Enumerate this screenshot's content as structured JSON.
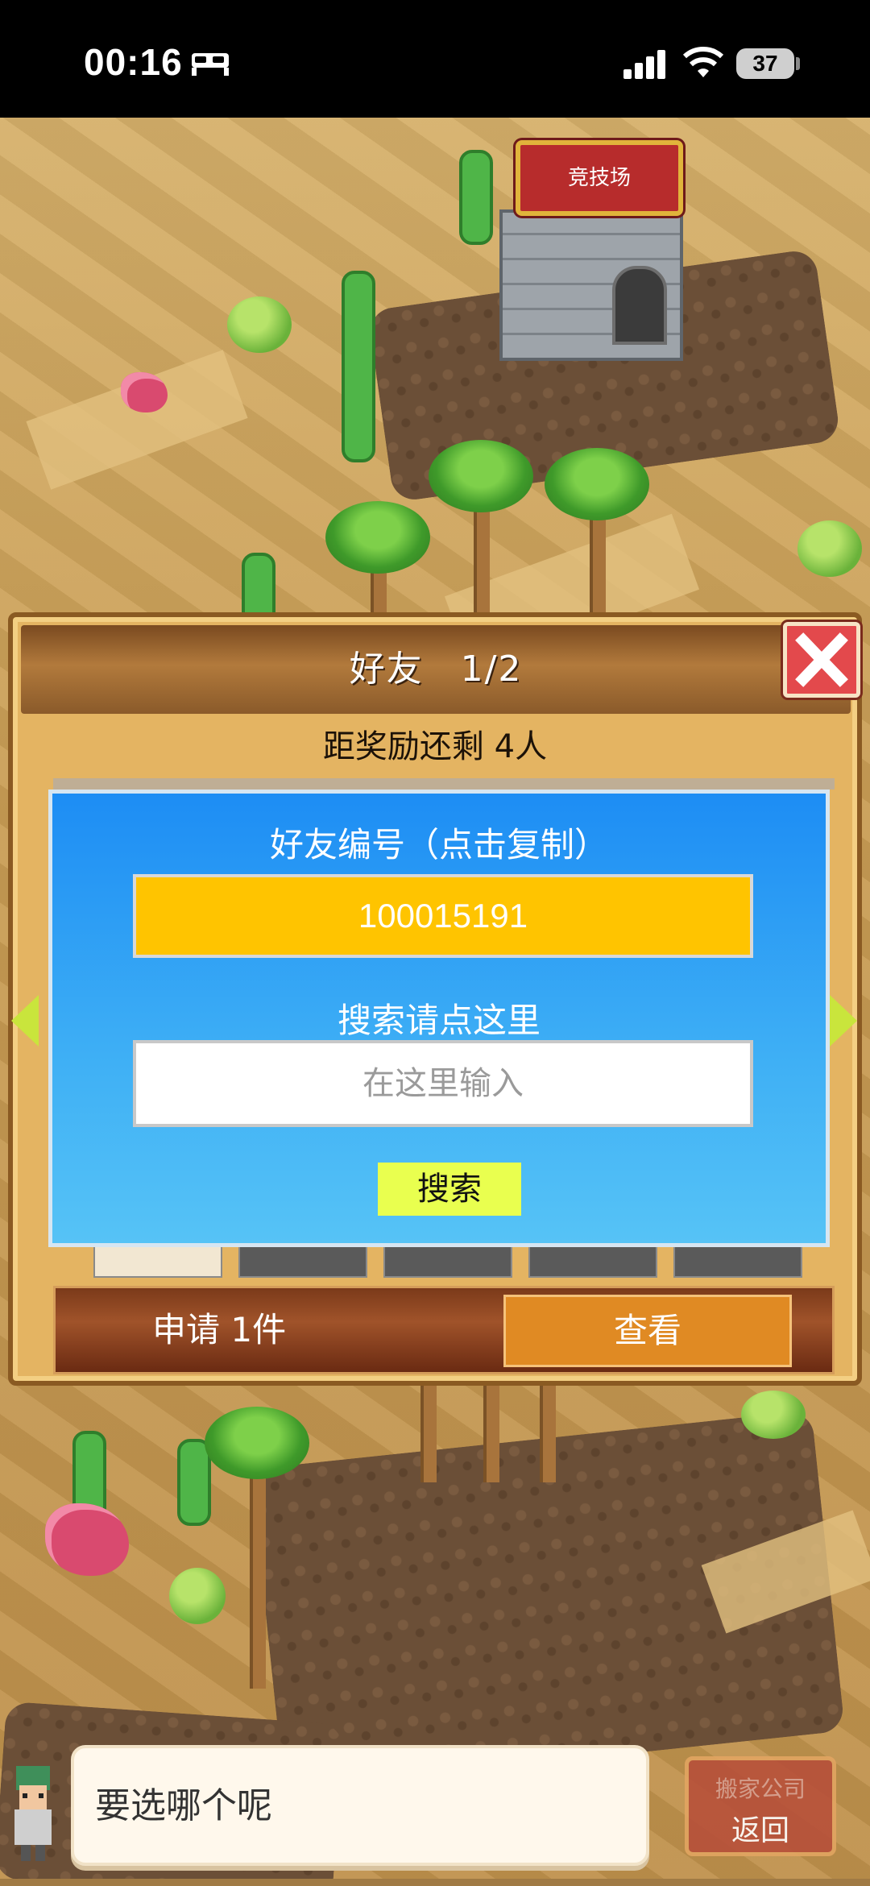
{
  "status_bar": {
    "time": "00:16",
    "battery": "37"
  },
  "map": {
    "arena_sign": "竞技场"
  },
  "friends_dialog": {
    "title": "好友　1/2",
    "reward_remaining": "距奖励还剩 4人",
    "friend_id_label": "好友编号（点击复制）",
    "friend_id": "100015191",
    "search_label": "搜索请点这里",
    "search_placeholder": "在这里输入",
    "search_button": "搜索",
    "requests_text": "申请 1件",
    "view_button": "查看"
  },
  "chat": {
    "message": "要选哪个呢"
  },
  "back_button": {
    "ghost_label": "搬家公司",
    "label": "返回"
  },
  "colors": {
    "accent_orange": "#e08a23",
    "id_box_yellow": "#ffc400",
    "panel_blue": "#1d8df4",
    "close_red": "#e3494c"
  }
}
